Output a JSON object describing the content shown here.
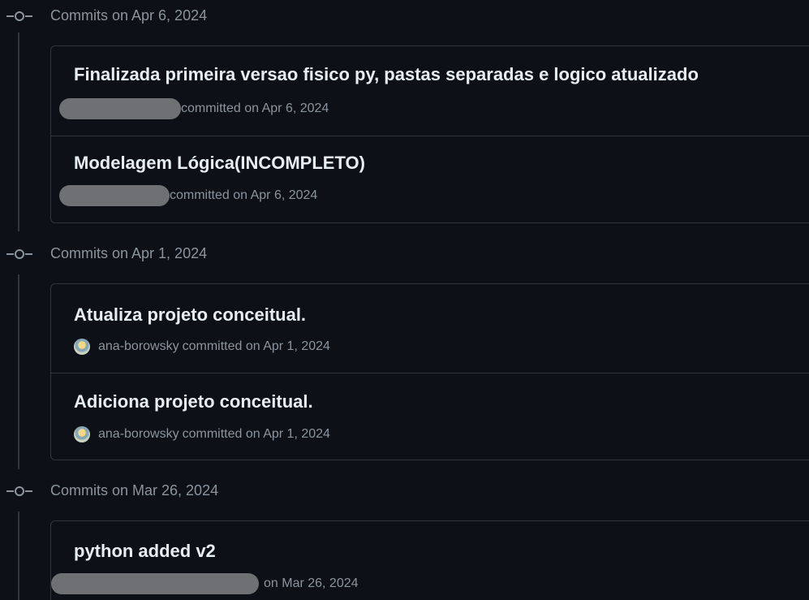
{
  "groups": [
    {
      "title": "Commits on Apr 6, 2024",
      "commits": [
        {
          "title": "Finalizada primeira versao fisico py, pastas separadas e logico atualizado",
          "author": "",
          "meta": "committed on Apr 6, 2024",
          "author_redacted": true
        },
        {
          "title": "Modelagem Lógica(INCOMPLETO)",
          "author": "",
          "meta": "committed on Apr 6, 2024",
          "author_redacted": true
        }
      ]
    },
    {
      "title": "Commits on Apr 1, 2024",
      "commits": [
        {
          "title": "Atualiza projeto conceitual.",
          "author": "ana-borowsky",
          "meta": "committed on Apr 1, 2024",
          "author_redacted": false
        },
        {
          "title": "Adiciona projeto conceitual.",
          "author": "ana-borowsky",
          "meta": "committed on Apr 1, 2024",
          "author_redacted": false
        }
      ]
    },
    {
      "title": "Commits on Mar 26, 2024",
      "commits": [
        {
          "title": "python added v2",
          "author": "",
          "meta": "on Mar 26, 2024",
          "author_redacted": true
        }
      ]
    }
  ],
  "colors": {
    "background": "#0d1117",
    "border": "#30363d",
    "muted": "#8b949e",
    "text": "#e6edf3",
    "redaction": "#6e7073"
  },
  "icons": {
    "group_marker": "git-commit-icon",
    "avatar": "user-avatar"
  }
}
